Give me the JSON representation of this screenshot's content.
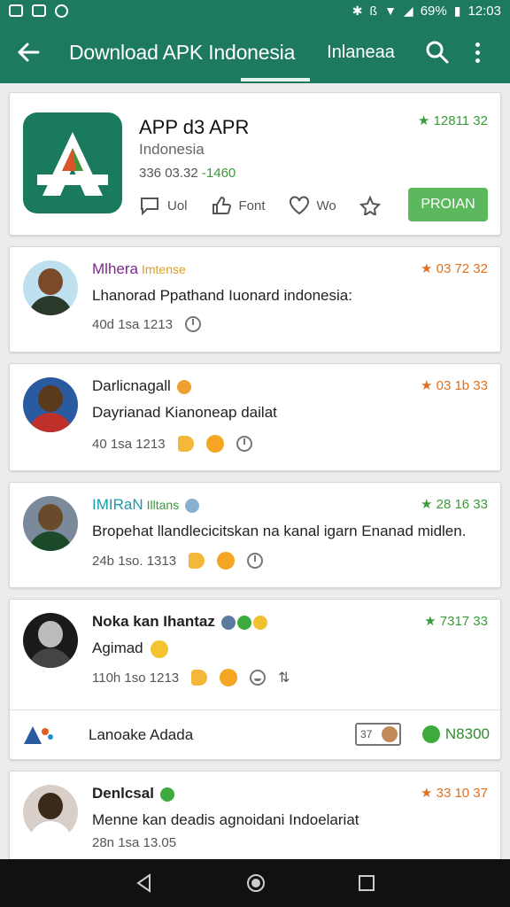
{
  "status_bar": {
    "left_icons": [
      "image-icon",
      "photo-icon",
      "notification-icon"
    ],
    "battery": "69%",
    "time": "12:03"
  },
  "app_bar": {
    "title": "Download APK Indonesia",
    "tab": "Inlaneaa"
  },
  "app": {
    "name": "APP d3 APR",
    "subtitle": "Indonesia",
    "meta_prefix": "336 03.32 ",
    "meta_highlight": "-1460",
    "rating": "★ 12811  32",
    "actions": [
      {
        "icon": "comment-icon",
        "label": "Uol"
      },
      {
        "icon": "thumbs-up-icon",
        "label": "Font"
      },
      {
        "icon": "heart-icon",
        "label": "Wo"
      },
      {
        "icon": "star-icon",
        "label": ""
      }
    ],
    "install_label": "PROIAN",
    "colors": {
      "brand": "#1e7a5e",
      "install": "#5cb85c",
      "rating_green": "#3a9a3a",
      "rating_orange": "#e07020"
    }
  },
  "reviews": [
    {
      "name": "Mlhera",
      "name_color": "#7a2a8a",
      "sub": "Imtense",
      "sub_color": "#e0a020",
      "rating": "★ 03 72 32",
      "rating_color": "#e07020",
      "text": "Lhanorad Ppathand Iuonard indonesia:",
      "meta": "40d 1sa 1213"
    },
    {
      "name": "Darlicnagall",
      "name_color": "#222222",
      "sub": "",
      "sub_color": "#222222",
      "rating": "★ 03 1b 33",
      "rating_color": "#e07020",
      "text": "Dayrianad Kianoneap dailat",
      "meta": "40 1sa 1213"
    },
    {
      "name": "IMIRaN",
      "name_color": "#1a9ab0",
      "sub": "Illtans",
      "sub_color": "#3a9a3a",
      "rating": "★ 28 16 33",
      "rating_color": "#3a9a3a",
      "text": "Bropehat llandlecicitskan na kanal igarn Enanad midlen.",
      "meta": "24b 1so. 1313"
    },
    {
      "name": "Noka kan Ihantaz",
      "name_color": "#111111",
      "sub": "",
      "sub_color": "#111111",
      "rating": "★ 7317  33",
      "rating_color": "#3a9a3a",
      "text": "Agimad",
      "meta": "110h 1so 1213",
      "ad": {
        "label": "Lanoake Adada",
        "chip": "37",
        "right": "N8300"
      }
    },
    {
      "name": "Denlcsal",
      "name_color": "#111111",
      "sub": "",
      "sub_color": "#111111",
      "rating": "★ 33 10 37",
      "rating_color": "#e07020",
      "text": "Menne kan deadis agnoidani Indoelariat",
      "meta": "28n 1sa 13.05"
    }
  ]
}
